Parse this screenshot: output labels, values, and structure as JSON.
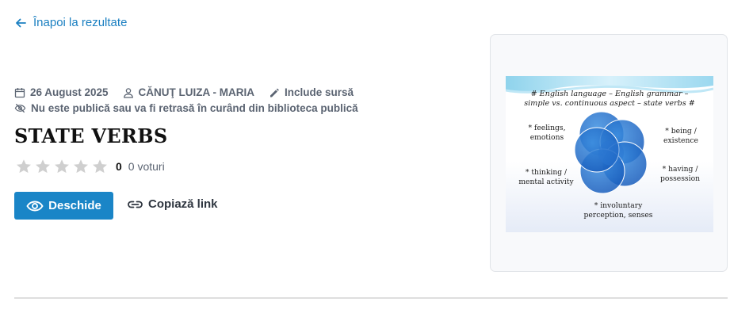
{
  "back_link": {
    "label": "Înapoi la rezultate",
    "icon": "arrow-left-icon"
  },
  "meta": {
    "date": "26 August 2025",
    "author": "CĂNUŢ LUIZA - MARIA",
    "source": "Include sursă",
    "notice": "Nu este publică sau va fi retrasă în curând din biblioteca publică"
  },
  "document": {
    "title": "STATE VERBS"
  },
  "rating": {
    "stars_filled": 0,
    "stars_total": 5,
    "value": "0",
    "votes": "0 voturi"
  },
  "actions": {
    "open_label": "Deschide",
    "copy_label": "Copiază link"
  },
  "thumbnail": {
    "heading_line1": "# English language – English grammar –",
    "heading_line2": "simple vs. continuous aspect – state verbs #",
    "label_feelings_1": "* feelings,",
    "label_feelings_2": "emotions",
    "label_being_1": "* being /",
    "label_being_2": "existence",
    "label_thinking_1": "* thinking /",
    "label_thinking_2": "mental activity",
    "label_having_1": "* having /",
    "label_having_2": "possession",
    "label_perception_1": "* involuntary",
    "label_perception_2": "perception, senses"
  },
  "colors": {
    "accent": "#1a85c7",
    "link": "#1a7fc1",
    "muted": "#5b6472",
    "star": "#cfcfcf"
  }
}
